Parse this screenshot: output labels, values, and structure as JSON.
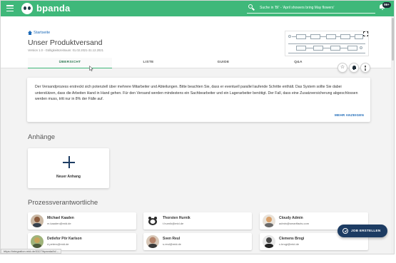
{
  "topbar": {
    "brand": "bpanda",
    "search_placeholder": "Suche in 'BI' - 'April showers bring May flowers'",
    "notification_badge": "99+",
    "color": "#3fb87a"
  },
  "header": {
    "breadcrumb": "Startseite",
    "title": "Unser Produktversand",
    "version_meta": "Version 1.0 - Gültigkeitszeitraum: 01.02.2021-31.12.2021"
  },
  "tabs": [
    {
      "label": "ÜBERSICHT",
      "active": true
    },
    {
      "label": "LISTE",
      "active": false
    },
    {
      "label": "GUIDE",
      "active": false
    },
    {
      "label": "Q&A",
      "active": false
    }
  ],
  "description": {
    "text": "Der Versandprozess erstreckt sich potenziell über mehrere Mitarbeiter und Abteilungen. Bitte beachten Sie, dass er eventuell parallel laufende Schritte enthält. Das System sollte Sie dabei unterstützen, dass die Arbeiten Hand in Hand gehen. Für den Versand werden mindestens ein Sachbearbeiter und ein Lagerarbeiter benötigt. Der Fall, dass eine Zusatzversicherung abgeschlossen werden muss, tritt nur in 8% der Fälle auf.",
    "more_label": "MEHR ANZEIGEN"
  },
  "attachments": {
    "title": "Anhänge",
    "new_label": "Neuer Anhang"
  },
  "responsibles": {
    "title": "Prozessverantwortliche",
    "people": [
      {
        "name": "Michael Kaaden",
        "email": "m.kaaden@mid.de",
        "avatar_color": "#8a5a3c"
      },
      {
        "name": "Thorsten Hurnik",
        "email": "t.hurnik@mid.de",
        "avatar_color": "#ffffff"
      },
      {
        "name": "Cloudy Admin",
        "email": "admin@smartfacts.com",
        "avatar_color": "#d9a06a"
      },
      {
        "name": "Detlefor Pör Karlson",
        "email": "d.peters@mid.de",
        "avatar_color": "#c9a35a"
      },
      {
        "name": "Sven Reul",
        "email": "s.reul@mid.de",
        "avatar_color": "#b4836a"
      },
      {
        "name": "Clemens Brogi",
        "email": "c.brogi@mid.de",
        "avatar_color": "#4a4a4a"
      }
    ]
  },
  "fab": {
    "label": "JOB ERSTELLEN",
    "color": "#1d3c63"
  },
  "statusbar": {
    "url": "https://integration.mid.de/3327/bpanda/bi/..."
  }
}
